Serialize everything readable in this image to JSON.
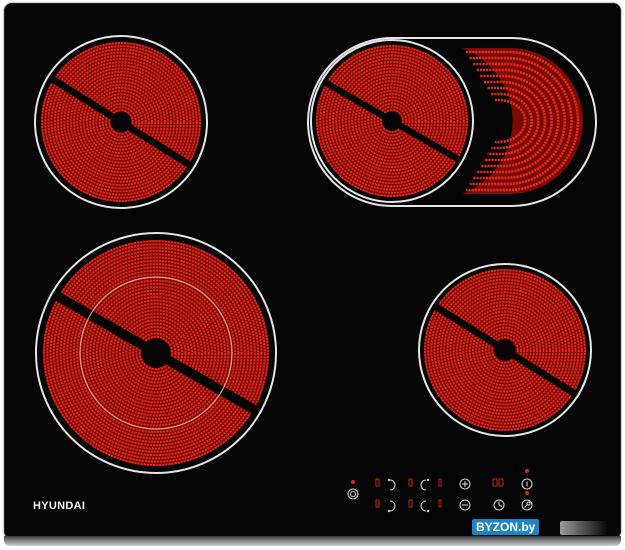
{
  "brand": {
    "name": "HYUNDAI"
  },
  "watermark": {
    "text": "BYZON.by"
  },
  "colors": {
    "glass": "#050505",
    "heater": "#e8281c",
    "heater_dark": "#7a0c06",
    "rim": "#e6e6e6",
    "indicator": "#e0241b",
    "control": "#cfcfcf"
  },
  "zones": [
    {
      "name": "rear-left",
      "shape": "circle"
    },
    {
      "name": "rear-right-dual",
      "shape": "oval-extension"
    },
    {
      "name": "front-left-dual",
      "shape": "circle"
    },
    {
      "name": "front-right",
      "shape": "circle"
    }
  ],
  "controls": [
    {
      "name": "power",
      "icon": "power-icon"
    },
    {
      "name": "zone1-select",
      "icon": "zone-select-icon"
    },
    {
      "name": "zone2-select",
      "icon": "zone-select-icon"
    },
    {
      "name": "zone3-select",
      "icon": "zone-select-icon"
    },
    {
      "name": "zone4-select",
      "icon": "zone-select-icon"
    },
    {
      "name": "plus",
      "icon": "plus-icon"
    },
    {
      "name": "minus",
      "icon": "minus-icon"
    },
    {
      "name": "timer",
      "icon": "clock-icon"
    },
    {
      "name": "lock",
      "icon": "key-icon"
    },
    {
      "name": "dual-zone",
      "icon": "dual-ring-icon"
    }
  ]
}
